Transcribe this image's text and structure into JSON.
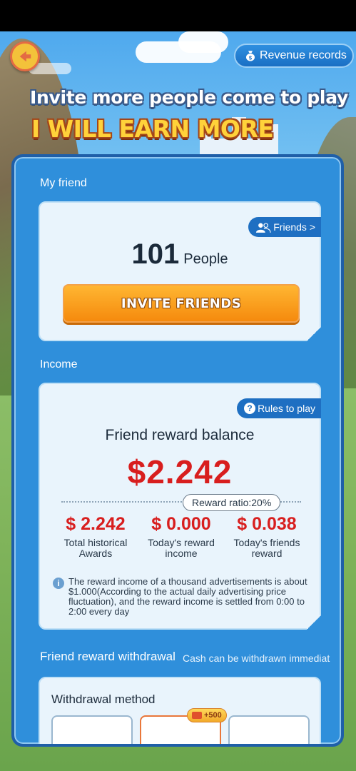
{
  "header": {
    "revenue_records_label": "Revenue records",
    "banner_line1": "Invite more people come to play",
    "banner_line2": "I WILL EARN MORE"
  },
  "my_friend": {
    "section_label": "My friend",
    "friends_button_label": "Friends >",
    "count": "101",
    "count_unit": "People",
    "invite_button_label": "INVITE FRIENDS"
  },
  "income": {
    "section_label": "Income",
    "rules_button_label": "Rules to play",
    "balance_title": "Friend reward balance",
    "balance_value": "$2.242",
    "reward_ratio_label": "Reward ratio:20%",
    "stats": [
      {
        "value": "$ 2.242",
        "label": "Total historical Awards"
      },
      {
        "value": "$ 0.000",
        "label": "Today's reward income"
      },
      {
        "value": "$ 0.038",
        "label": "Today's friends reward"
      }
    ],
    "note": "The reward income of a thousand advertisements is about $1.000(According to the actual daily advertising price fluctuation), and the reward income is settled from 0:00 to 2:00 every day"
  },
  "withdrawal": {
    "title": "Friend reward withdrawal",
    "subtitle": "Cash can be withdrawn immediat",
    "method_label": "Withdrawal method",
    "bonus_label": "+500"
  },
  "colors": {
    "panel_blue": "#2f8fdb",
    "accent_orange": "#f58a0d",
    "money_red": "#d81e1e"
  }
}
